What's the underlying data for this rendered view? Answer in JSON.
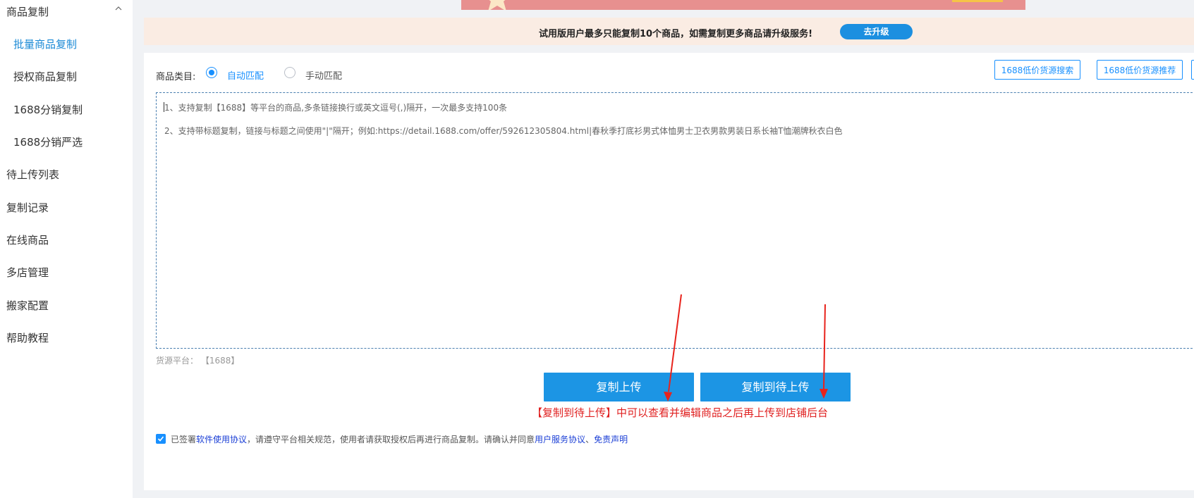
{
  "sidebar": {
    "group_label": "商品复制",
    "sub_items": [
      {
        "label": "批量商品复制",
        "active": true
      },
      {
        "label": "授权商品复制"
      },
      {
        "label": "1688分销复制"
      },
      {
        "label": "1688分销严选"
      }
    ],
    "items": [
      {
        "label": "待上传列表"
      },
      {
        "label": "复制记录"
      },
      {
        "label": "在线商品"
      },
      {
        "label": "多店管理"
      },
      {
        "label": "搬家配置"
      },
      {
        "label": "帮助教程"
      }
    ]
  },
  "notice": {
    "text": "试用版用户最多只能复制10个商品，如需复制更多商品请升级服务!",
    "upgrade_label": "去升级"
  },
  "form": {
    "category_label": "商品类目:",
    "radio_auto": "自动匹配",
    "radio_manual": "手动匹配",
    "selected": "自动匹配",
    "source_buttons": [
      "1688低价货源搜索",
      "1688低价货源推荐",
      ""
    ],
    "placeholder_lines": [
      "1、支持复制【1688】等平台的商品,多条链接换行或英文逗号(,)隔开，一次最多支持100条",
      "2、支持带标题复制，链接与标题之间使用\"|\"隔开；例如:https://detail.1688.com/offer/592612305804.html|春秋季打底衫男式体恤男士卫衣男款男装日系长袖T恤潮牌秋衣白色"
    ],
    "platform_label": "货源平台：",
    "platform_value": "【1688】",
    "copy_upload_label": "复制上传",
    "copy_pending_label": "复制到待上传",
    "hint": "【复制到待上传】中可以查看并编辑商品之后再上传到店铺后台",
    "agreement": {
      "checked": true,
      "prefix": "已签署",
      "link1": "软件使用协议",
      "middle": "，请遵守平台相关规范，使用者请获取授权后再进行商品复制。请确认并同意",
      "link2": "用户服务协议",
      "separator": "、",
      "link3": "免责声明"
    }
  },
  "colors": {
    "primary": "#1c95e4",
    "notice_bg": "#faece3",
    "hint_red": "#e02020",
    "arrow_red": "#e8231c",
    "banner": "#e7908f"
  }
}
